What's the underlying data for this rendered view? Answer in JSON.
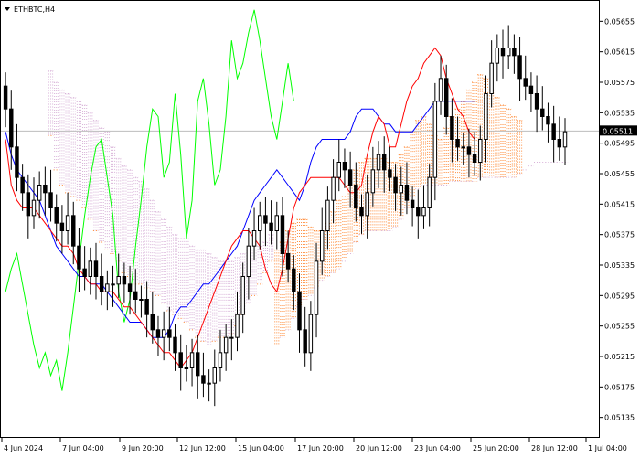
{
  "chart_data": {
    "type": "candlestick",
    "title": "ETHBTC,H4",
    "ylim": [
      0.05125,
      0.05665
    ],
    "y_ticks": [
      "0.05655",
      "0.05615",
      "0.05575",
      "0.05535",
      "0.05495",
      "0.05455",
      "0.05415",
      "0.05375",
      "0.05335",
      "0.05295",
      "0.05255",
      "0.05215",
      "0.05175",
      "0.05135"
    ],
    "x_ticks": [
      "4 Jun 2024",
      "7 Jun 04:00",
      "9 Jun 20:00",
      "12 Jun 12:00",
      "15 Jun 04:00",
      "17 Jun 20:00",
      "20 Jun 12:00",
      "23 Jun 04:00",
      "25 Jun 20:00",
      "28 Jun 12:00",
      "1 Jul 04:00"
    ],
    "current_price": "0.05511",
    "colors": {
      "candle": "#000000",
      "tenkan": "#ff0000",
      "kijun": "#0000ff",
      "chikou": "#00ff00",
      "senkou_a": "#ff8c3a",
      "senkou_b": "#d8b2d8",
      "price_tag": "#000000"
    },
    "close": [
      0.0554,
      0.0549,
      0.0545,
      0.0543,
      0.054,
      0.0542,
      0.0544,
      0.0543,
      0.0541,
      0.0539,
      0.0538,
      0.054,
      0.0536,
      0.0533,
      0.0532,
      0.0534,
      0.0532,
      0.053,
      0.0531,
      0.0531,
      0.0532,
      0.0531,
      0.053,
      0.0529,
      0.0529,
      0.0527,
      0.0525,
      0.0524,
      0.0525,
      0.0524,
      0.0522,
      0.052,
      0.052,
      0.0522,
      0.0519,
      0.0518,
      0.0518,
      0.052,
      0.0522,
      0.0524,
      0.0524,
      0.0527,
      0.0532,
      0.0536,
      0.0538,
      0.054,
      0.0539,
      0.0538,
      0.054,
      0.0535,
      0.0533,
      0.053,
      0.0525,
      0.0522,
      0.0527,
      0.0534,
      0.0538,
      0.0542,
      0.0545,
      0.0547,
      0.0546,
      0.0544,
      0.0541,
      0.054,
      0.0543,
      0.0546,
      0.0548,
      0.0546,
      0.0545,
      0.0543,
      0.0544,
      0.0542,
      0.0541,
      0.054,
      0.0541,
      0.0545,
      0.0555,
      0.0558,
      0.0553,
      0.055,
      0.0549,
      0.0549,
      0.0548,
      0.0547,
      0.055,
      0.0556,
      0.056,
      0.0562,
      0.0561,
      0.0562,
      0.0561,
      0.0558,
      0.0557,
      0.0556,
      0.0554,
      0.0553,
      0.0552,
      0.055,
      0.0549,
      0.0551
    ],
    "tenkan": [
      0.055,
      0.0544,
      0.0542,
      0.0541,
      0.0541,
      0.0541,
      0.054,
      0.0539,
      0.0538,
      0.0537,
      0.0536,
      0.0536,
      0.0535,
      0.0533,
      0.0532,
      0.0531,
      0.0531,
      0.053,
      0.053,
      0.053,
      0.0529,
      0.0528,
      0.0528,
      0.0527,
      0.0526,
      0.0525,
      0.0524,
      0.0523,
      0.0522,
      0.0522,
      0.0521,
      0.052,
      0.0521,
      0.0522,
      0.0524,
      0.0526,
      0.0528,
      0.053,
      0.0532,
      0.0534,
      0.0536,
      0.0537,
      0.0538,
      0.0538,
      0.0537,
      0.0536,
      0.0533,
      0.0531,
      0.053,
      0.0533,
      0.0537,
      0.0541,
      0.0543,
      0.0544,
      0.0545,
      0.0545,
      0.0545,
      0.0545,
      0.0545,
      0.0545,
      0.0544,
      0.0543,
      0.0543,
      0.0544,
      0.0548,
      0.0551,
      0.0553,
      0.0552,
      0.0549,
      0.0549,
      0.0552,
      0.0555,
      0.0557,
      0.0558,
      0.056,
      0.0561,
      0.0562,
      0.0561,
      0.0558,
      0.0556,
      0.0554,
      0.0553,
      0.0551,
      0.055
    ],
    "kijun": [
      0.0551,
      0.0548,
      0.0546,
      0.0545,
      0.0544,
      0.0543,
      0.0542,
      0.054,
      0.0538,
      0.0536,
      0.0535,
      0.0534,
      0.0533,
      0.0532,
      0.0532,
      0.0531,
      0.0531,
      0.0531,
      0.053,
      0.0529,
      0.0528,
      0.0527,
      0.0526,
      0.0526,
      0.0526,
      0.0525,
      0.0524,
      0.0524,
      0.0524,
      0.0525,
      0.0527,
      0.0528,
      0.0528,
      0.0529,
      0.053,
      0.0531,
      0.0531,
      0.0532,
      0.0533,
      0.0534,
      0.0535,
      0.0536,
      0.0538,
      0.054,
      0.0542,
      0.0543,
      0.0544,
      0.0545,
      0.0546,
      0.0545,
      0.0544,
      0.0543,
      0.0542,
      0.0544,
      0.0547,
      0.0549,
      0.055,
      0.055,
      0.055,
      0.055,
      0.055,
      0.0551,
      0.0553,
      0.0554,
      0.0554,
      0.0554,
      0.0553,
      0.0552,
      0.0552,
      0.0551,
      0.0551,
      0.0551,
      0.0551,
      0.0552,
      0.0553,
      0.0554,
      0.0555,
      0.0555,
      0.0555,
      0.0555,
      0.0555,
      0.0555,
      0.0555,
      0.0555
    ],
    "chikou": [
      0.053,
      0.0533,
      0.0535,
      0.0531,
      0.0527,
      0.0523,
      0.052,
      0.0522,
      0.0519,
      0.0521,
      0.0517,
      0.0522,
      0.0528,
      0.0534,
      0.054,
      0.0545,
      0.0549,
      0.055,
      0.0545,
      0.054,
      0.053,
      0.0526,
      0.0529,
      0.0536,
      0.0542,
      0.0549,
      0.0554,
      0.0553,
      0.0545,
      0.0547,
      0.0556,
      0.0548,
      0.0537,
      0.0542,
      0.0555,
      0.0558,
      0.0552,
      0.0544,
      0.0546,
      0.0553,
      0.0563,
      0.0558,
      0.056,
      0.0564,
      0.0567,
      0.0563,
      0.0558,
      0.0553,
      0.055,
      0.0555,
      0.056,
      0.0555
    ]
  }
}
